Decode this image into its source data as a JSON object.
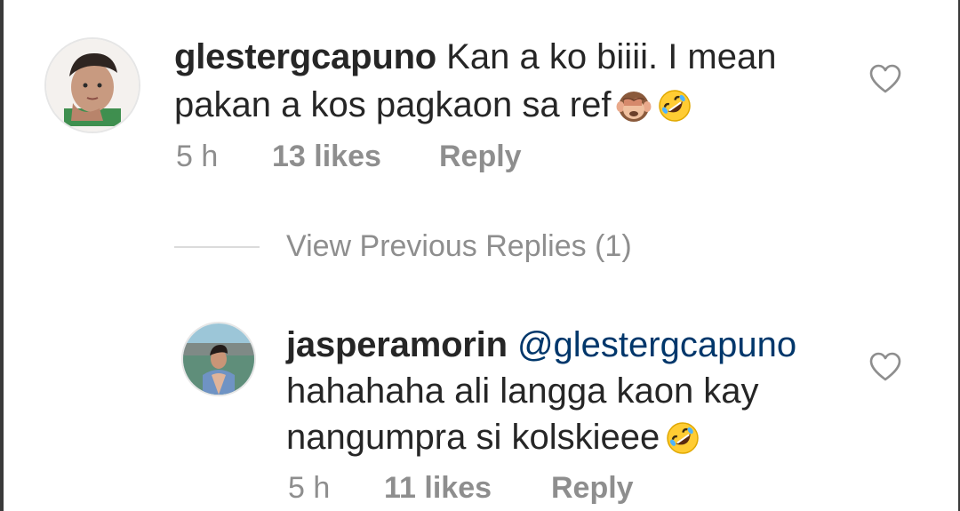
{
  "comments": [
    {
      "username": "glestergcapuno",
      "text_line1": "Kan a ko biiii. I mean",
      "text_line2": "pakan a kos pagkaon sa ref",
      "time": "5 h",
      "likes": "13 likes",
      "reply_label": "Reply",
      "emojis": [
        "see-no-evil-monkey-icon",
        "rolling-on-floor-laughing-icon"
      ]
    },
    {
      "username": "jasperamorin",
      "mention": "@glestergcapuno",
      "text_line2": "hahahaha ali langga kaon kay",
      "text_line3": "nangumpra si kolskieee",
      "time": "5 h",
      "likes": "11 likes",
      "reply_label": "Reply",
      "emojis": [
        "rolling-on-floor-laughing-icon"
      ]
    }
  ],
  "view_previous_replies": "View Previous Replies (1)",
  "colors": {
    "text": "#262626",
    "meta": "#8e8e8e",
    "mention": "#00376b",
    "divider": "#dbdbdb"
  }
}
